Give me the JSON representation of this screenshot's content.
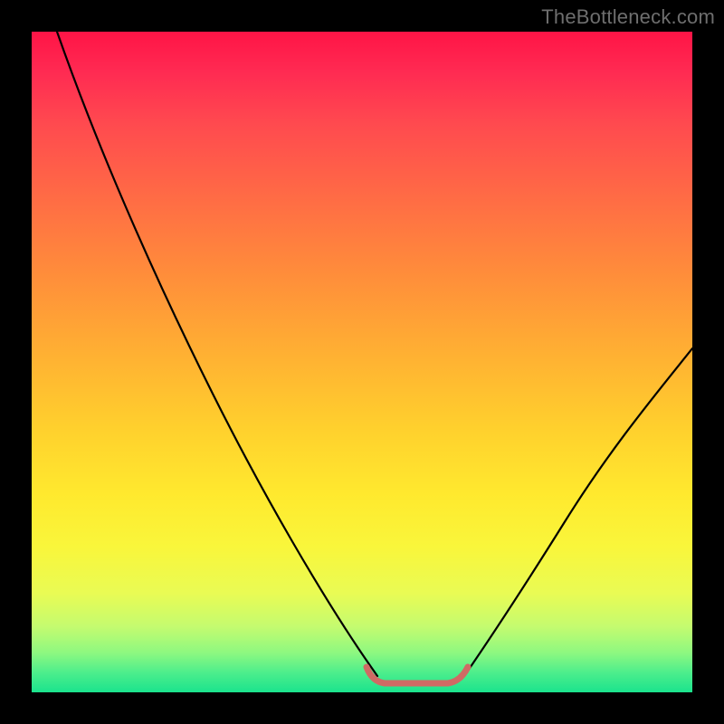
{
  "watermark": {
    "text": "TheBottleneck.com"
  },
  "chart_data": {
    "type": "line",
    "title": "",
    "xlabel": "",
    "ylabel": "",
    "xlim": [
      0,
      1
    ],
    "ylim": [
      0,
      1
    ],
    "series": [
      {
        "name": "left-descending-curve",
        "x": [
          0.04,
          0.1,
          0.17,
          0.24,
          0.31,
          0.38,
          0.45,
          0.5,
          0.52
        ],
        "values": [
          1.0,
          0.86,
          0.71,
          0.56,
          0.41,
          0.26,
          0.12,
          0.04,
          0.02
        ]
      },
      {
        "name": "right-ascending-curve",
        "x": [
          0.65,
          0.7,
          0.76,
          0.82,
          0.88,
          0.94,
          1.0
        ],
        "values": [
          0.02,
          0.06,
          0.13,
          0.22,
          0.32,
          0.42,
          0.52
        ]
      },
      {
        "name": "bottom-floor-marker",
        "x": [
          0.5,
          0.52,
          0.55,
          0.58,
          0.61,
          0.64,
          0.66
        ],
        "values": [
          0.04,
          0.02,
          0.015,
          0.015,
          0.015,
          0.02,
          0.04
        ]
      }
    ],
    "colors": {
      "curve_stroke": "#000000",
      "floor_marker_stroke": "#d06a64",
      "background_gradient": [
        "#ff1446",
        "#ffd02d",
        "#1be38d"
      ]
    }
  }
}
